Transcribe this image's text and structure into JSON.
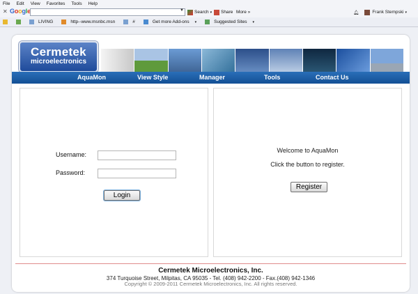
{
  "menu": [
    "File",
    "Edit",
    "View",
    "Favorites",
    "Tools",
    "Help"
  ],
  "toolbar": {
    "search_label": "Search",
    "share_label": "Share",
    "more_label": "More »",
    "user_name": "Frank Stempski"
  },
  "favorites": [
    "LIVING",
    "http--www.msnbc.msn",
    "#",
    "Get more Add-ons",
    "Suggested Sites"
  ],
  "logo": {
    "line1": "Cermetek",
    "line2": "microelectronics"
  },
  "nav": [
    "AquaMon",
    "View Style",
    "Manager",
    "Tools",
    "Contact Us"
  ],
  "login": {
    "username_label": "Username:",
    "password_label": "Password:",
    "login_button": "Login"
  },
  "register": {
    "welcome": "Welcome to AquaMon",
    "instructions": "Click the button to register.",
    "register_button": "Register"
  },
  "footer": {
    "company": "Cermetek Microelectronics, Inc.",
    "address": "374 Turquoise Street, Milpitas, CA 95035  - Tel. (408) 942-2200  - Fax.(408) 942-1346",
    "copyright": "Copyright © 2009-2011 Cermetek Microelectronics, Inc.  All rights reserved."
  },
  "colors": {
    "nav_bar": "#1d5da6",
    "logo_blue": "#2a5aa8",
    "footer_line": "#e08c8c"
  }
}
